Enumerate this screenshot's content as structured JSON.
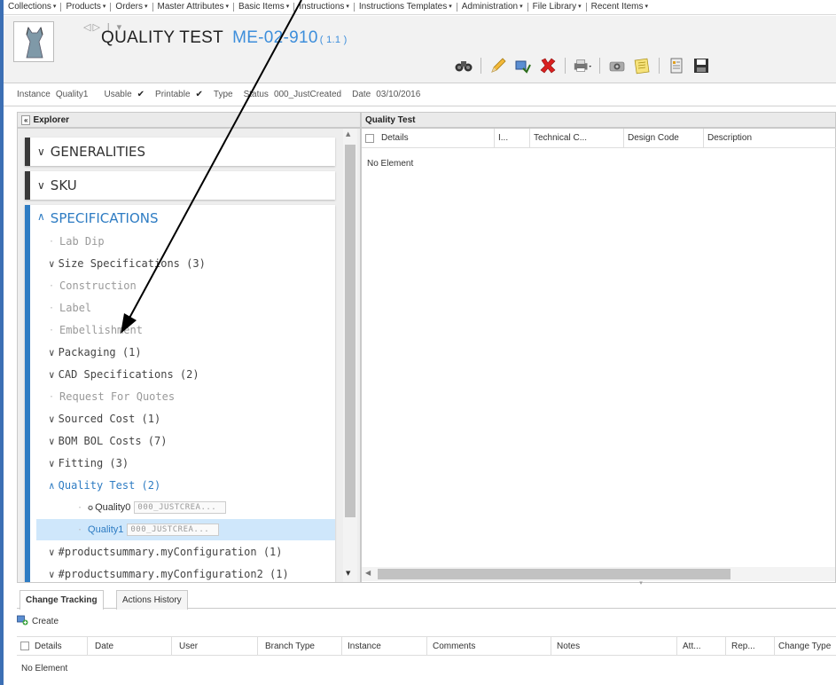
{
  "menu": [
    "Collections",
    "Products",
    "Orders",
    "Master Attributes",
    "Basic Items",
    "Instructions",
    "Instructions Templates",
    "Administration",
    "File Library",
    "Recent Items"
  ],
  "header": {
    "title": "QUALITY TEST",
    "code": "ME-02-910",
    "version": "( 1.1 )"
  },
  "info": {
    "instance_label": "Instance",
    "instance_value": "Quality1",
    "usable": "Usable",
    "printable": "Printable",
    "type": "Type",
    "status_label": "Status",
    "status_value": "000_JustCreated",
    "date_label": "Date",
    "date_value": "03/10/2016"
  },
  "explorer": {
    "title": "Explorer"
  },
  "sections": {
    "generalities": "GENERALITIES",
    "sku": "SKU",
    "specifications": "SPECIFICATIONS"
  },
  "tree": [
    {
      "label": "Lab Dip"
    },
    {
      "label": "Size Specifications (3)"
    },
    {
      "label": "Construction"
    },
    {
      "label": "Label"
    },
    {
      "label": "Embellishment"
    },
    {
      "label": "Packaging (1)"
    },
    {
      "label": "CAD Specifications (2)"
    },
    {
      "label": "Request For Quotes"
    },
    {
      "label": "Sourced Cost (1)"
    },
    {
      "label": "BOM BOL Costs (7)"
    },
    {
      "label": "Fitting (3)"
    },
    {
      "label": "Quality Test (2)"
    },
    {
      "label": "Quality0",
      "tag": "000_JUSTCREA..."
    },
    {
      "label": "Quality1",
      "tag": "000_JUSTCREA..."
    },
    {
      "label": "#productsummary.myConfiguration (1)"
    },
    {
      "label": "#productsummary.myConfiguration2 (1)"
    }
  ],
  "right": {
    "title": "Quality Test",
    "columns": [
      "Details",
      "I...",
      "Technical C...",
      "Design Code",
      "Description"
    ],
    "empty": "No Element"
  },
  "bottom": {
    "tabs": [
      "Change Tracking",
      "Actions History"
    ],
    "create": "Create",
    "columns": [
      "Details",
      "Date",
      "User",
      "Branch Type",
      "Instance",
      "Comments",
      "Notes",
      "Att...",
      "Rep...",
      "Change Type"
    ],
    "empty": "No Element"
  }
}
